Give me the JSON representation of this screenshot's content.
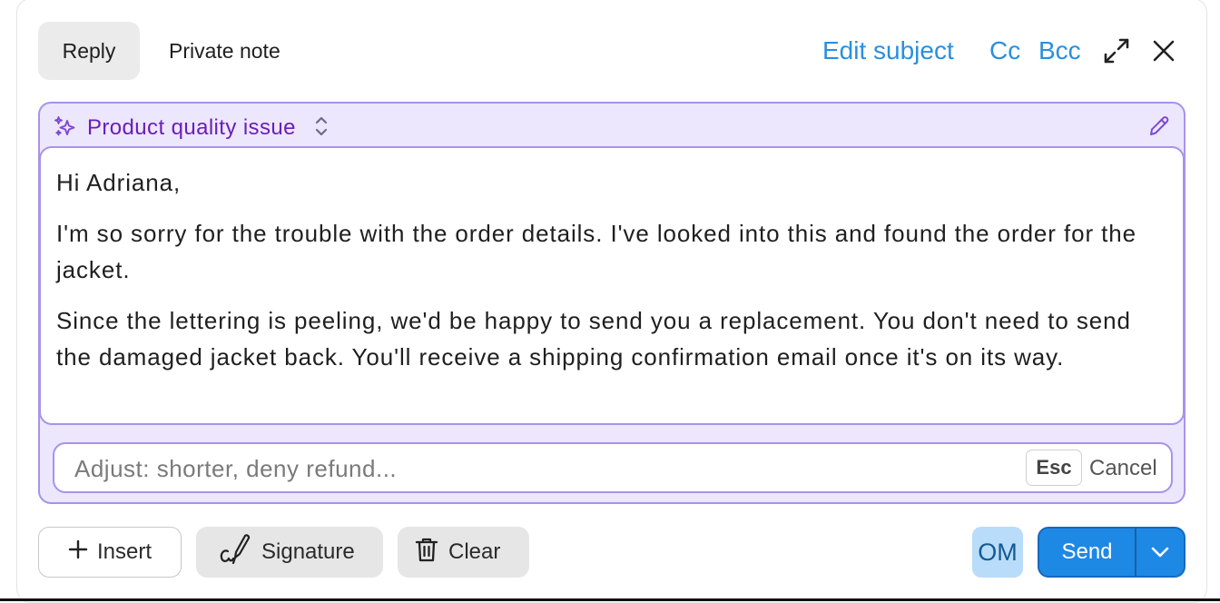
{
  "header": {
    "tabs": [
      {
        "label": "Reply",
        "active": true
      },
      {
        "label": "Private note",
        "active": false
      }
    ],
    "edit_subject": "Edit subject",
    "cc": "Cc",
    "bcc": "Bcc",
    "icons": {
      "expand": "expand-icon",
      "close": "close-icon"
    }
  },
  "ai_suggestion": {
    "icon": "sparkle-icon",
    "title": "Product quality issue",
    "switch_icon": "chevron-up-down-icon",
    "edit_icon": "pencil-icon",
    "draft": {
      "greeting": "Hi Adriana,",
      "paragraph_1": "I'm so sorry for the trouble with the order details. I've looked into this and found the order for the jacket.",
      "paragraph_2": "Since the lettering is peeling, we'd be happy to send you a replacement. You don't need to send the damaged jacket back. You'll receive a shipping confirmation email once it's on its way."
    },
    "adjust": {
      "placeholder": "Adjust: shorter, deny refund...",
      "value": "",
      "esc_key": "Esc",
      "cancel": "Cancel"
    }
  },
  "footer": {
    "insert": {
      "label": "Insert",
      "icon": "plus-icon"
    },
    "signature": {
      "label": "Signature",
      "icon": "signature-pen-icon"
    },
    "clear": {
      "label": "Clear",
      "icon": "trash-icon"
    },
    "avatar_initials": "OM",
    "send": {
      "label": "Send",
      "dropdown_icon": "chevron-down-icon"
    }
  },
  "colors": {
    "link": "#2a8fe0",
    "ai_accent": "#a793ea",
    "ai_background": "#ece7fd",
    "ai_title": "#6a1fb8",
    "send": "#1e88e5",
    "avatar_bg": "#b9dcfa"
  }
}
